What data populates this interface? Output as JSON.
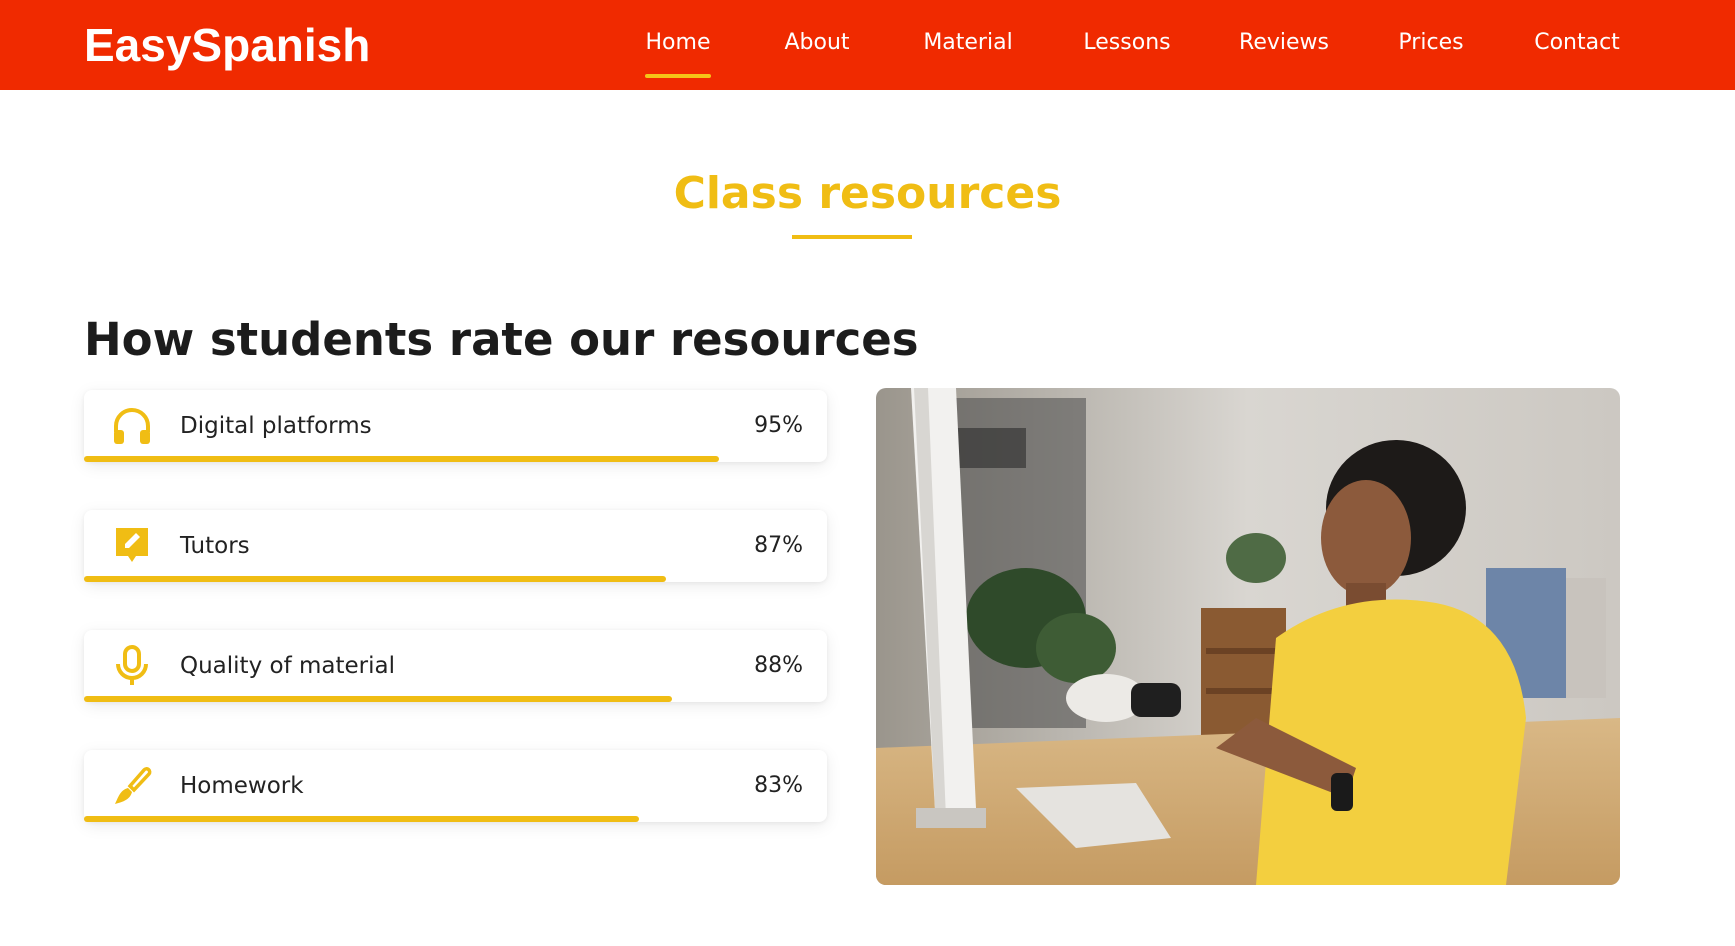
{
  "nav": {
    "brand": "EasySpanish",
    "links": [
      "Home",
      "About",
      "Material",
      "Lessons",
      "Reviews",
      "Prices",
      "Contact"
    ],
    "active": "Home"
  },
  "section": {
    "title": "Class resources"
  },
  "ratings": {
    "heading": "How students rate our resources",
    "items": [
      {
        "label": "Digital platforms",
        "percent_text": "95%",
        "value": 95,
        "icon": "headphones-icon"
      },
      {
        "label": "Tutors",
        "percent_text": "87%",
        "value": 87,
        "icon": "edit-note-icon"
      },
      {
        "label": "Quality of material",
        "percent_text": "88%",
        "value": 88,
        "icon": "microphone-icon"
      },
      {
        "label": "Homework",
        "percent_text": "83%",
        "value": 83,
        "icon": "paintbrush-icon"
      }
    ]
  },
  "photo": {
    "description_icon": "student-at-computer-photo"
  },
  "colors": {
    "nav_bg": "#f02a00",
    "accent": "#f0bd14",
    "text": "#222222"
  }
}
